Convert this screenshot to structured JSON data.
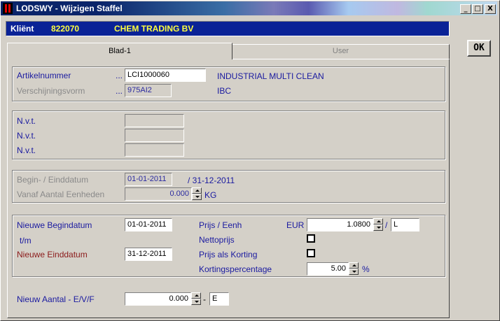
{
  "window": {
    "title": "LODSWY - Wijzigen Staffel",
    "min": "_",
    "max": "□",
    "close": "X"
  },
  "client": {
    "label": "Kliënt",
    "number": "822070",
    "name": "CHEM TRADING BV"
  },
  "ok_label": "OK",
  "tabs": [
    {
      "label": "Blad-1"
    },
    {
      "label": "User"
    }
  ],
  "article": {
    "nr_label": "Artikelnummer",
    "nr_dots": "...",
    "nr_value": "LCI1000060",
    "nr_desc": "INDUSTRIAL MULTI CLEAN",
    "form_label": "Verschijningsvorm",
    "form_dots": "...",
    "form_value": "975AI2",
    "form_desc": "IBC"
  },
  "nvt": {
    "label1": "N.v.t.",
    "label2": "N.v.t.",
    "label3": "N.v.t."
  },
  "current": {
    "date_label": "Begin- / Einddatum",
    "begin_value": "01-01-2011",
    "end_text": "/ 31-12-2011",
    "units_label": "Vanaf Aantal Eenheden",
    "units_value": "0.000",
    "unit": "KG"
  },
  "newdata": {
    "begin_label": "Nieuwe Begindatum",
    "begin_value": "01-01-2011",
    "tm_label": "t/m",
    "end_label": "Nieuwe Einddatum",
    "end_value": "31-12-2011",
    "price_label": "Prijs / Eenh",
    "currency": "EUR",
    "price_value": "1.0800",
    "slash": "/",
    "price_unit": "L",
    "netto_label": "Nettoprijs",
    "korting_label": "Prijs als Korting",
    "pct_label": "Kortingspercentage",
    "pct_value": "5.00",
    "pct_sign": "%"
  },
  "qty": {
    "label": "Nieuw Aantal -  E/V/F",
    "value": "0.000",
    "dash": "-",
    "type": "E"
  }
}
